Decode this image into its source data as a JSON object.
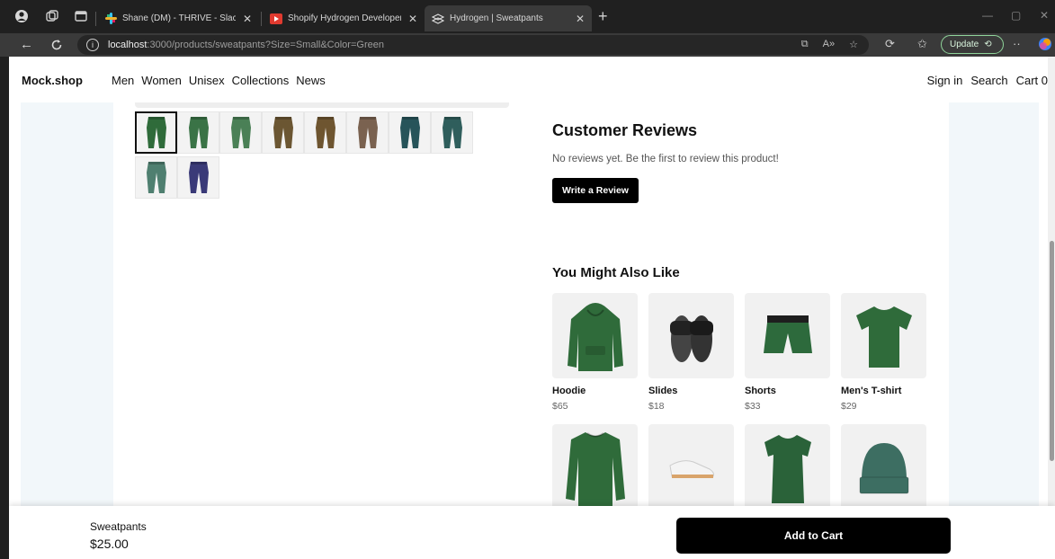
{
  "browser": {
    "tabs": [
      {
        "title": "Shane (DM) - THRIVE - Slack",
        "icon": "slack-icon"
      },
      {
        "title": "Shopify Hydrogen Developer Assi",
        "icon": "youtube-icon"
      },
      {
        "title": "Hydrogen | Sweatpants",
        "icon": "hydrogen-icon",
        "active": true
      }
    ],
    "url_host": "localhost",
    "url_path": ":3000/products/sweatpants?Size=Small&Color=Green",
    "update_label": "Update"
  },
  "header": {
    "brand": "Mock.shop",
    "nav": [
      "Men",
      "Women",
      "Unisex",
      "Collections",
      "News"
    ],
    "sign_in": "Sign in",
    "search": "Search",
    "cart": "Cart 0"
  },
  "thumbnails": [
    {
      "color": "#2f6b3a",
      "selected": true
    },
    {
      "color": "#3a7346"
    },
    {
      "color": "#4a8056"
    },
    {
      "color": "#6b5632"
    },
    {
      "color": "#6e5530"
    },
    {
      "color": "#7a6250"
    },
    {
      "color": "#27545a"
    },
    {
      "color": "#2f5e5c"
    },
    {
      "color": "#4f7f70"
    },
    {
      "color": "#3a3a78"
    }
  ],
  "reviews": {
    "title": "Customer Reviews",
    "empty_text": "No reviews yet. Be the first to review this product!",
    "write_button": "Write a Review"
  },
  "recommendations": {
    "title": "You Might Also Like",
    "products": [
      {
        "name": "Hoodie",
        "price": "$65",
        "icon": "hoodie-icon",
        "color": "#2f6b3a"
      },
      {
        "name": "Slides",
        "price": "$18",
        "icon": "slides-icon",
        "color": "#222222"
      },
      {
        "name": "Shorts",
        "price": "$33",
        "icon": "shorts-icon",
        "color": "#2d6a3c"
      },
      {
        "name": "Men's T-shirt",
        "price": "$29",
        "icon": "tshirt-icon",
        "color": "#2f6b3a"
      },
      {
        "name": "",
        "price": "",
        "icon": "sweatshirt-icon",
        "color": "#2f6b3a"
      },
      {
        "name": "",
        "price": "",
        "icon": "sneakers-icon",
        "color": "#f4f4f4"
      },
      {
        "name": "",
        "price": "",
        "icon": "womens-tshirt-icon",
        "color": "#2a6239"
      },
      {
        "name": "",
        "price": "",
        "icon": "beanie-icon",
        "color": "#3d6e62"
      }
    ]
  },
  "sticky": {
    "product_name": "Sweatpants",
    "price": "$25.00",
    "add_to_cart": "Add to Cart"
  }
}
